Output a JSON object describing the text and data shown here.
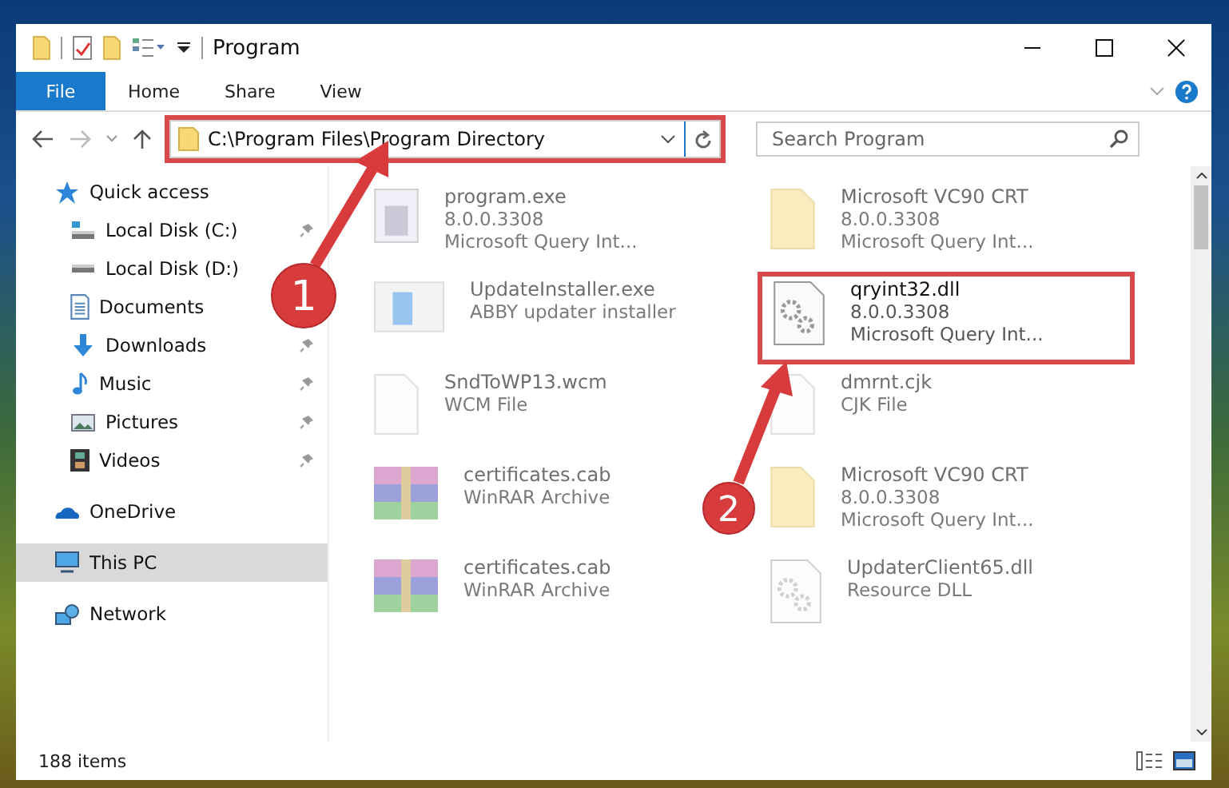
{
  "window": {
    "title": "Program"
  },
  "ribbon_tabs": [
    {
      "label": "File",
      "selected": true
    },
    {
      "label": "Home",
      "selected": false
    },
    {
      "label": "Share",
      "selected": false
    },
    {
      "label": "View",
      "selected": false
    }
  ],
  "address_bar": {
    "path": "C:\\Program Files\\Program Directory",
    "highlighted": true
  },
  "search": {
    "placeholder": "Search Program"
  },
  "sidebar": {
    "items": [
      {
        "label": "Quick access",
        "pinned": false,
        "selected": false
      },
      {
        "label": "Local Disk (C:)",
        "pinned": true,
        "selected": false
      },
      {
        "label": "Local Disk (D:)",
        "pinned": false,
        "selected": false
      },
      {
        "label": "Documents",
        "pinned": false,
        "selected": false
      },
      {
        "label": "Downloads",
        "pinned": true,
        "selected": false
      },
      {
        "label": "Music",
        "pinned": true,
        "selected": false
      },
      {
        "label": "Pictures",
        "pinned": true,
        "selected": false
      },
      {
        "label": "Videos",
        "pinned": true,
        "selected": false
      },
      {
        "label": "OneDrive",
        "pinned": false,
        "selected": false
      },
      {
        "label": "This PC",
        "pinned": false,
        "selected": true
      },
      {
        "label": "Network",
        "pinned": false,
        "selected": false
      }
    ]
  },
  "files": [
    {
      "name": "program.exe",
      "lines": [
        "8.0.0.3308",
        "Microsoft Query Int..."
      ],
      "faded": true,
      "highlighted": false
    },
    {
      "name": "Microsoft VC90 CRT",
      "lines": [
        "8.0.0.3308",
        "Microsoft Query Int..."
      ],
      "faded": true,
      "highlighted": false
    },
    {
      "name": "UpdateInstaller.exe",
      "lines": [
        "ABBY updater installer"
      ],
      "faded": true,
      "highlighted": false
    },
    {
      "name": "qryint32.dll",
      "lines": [
        "8.0.0.3308",
        "Microsoft Query Int..."
      ],
      "faded": false,
      "highlighted": true
    },
    {
      "name": "SndToWP13.wcm",
      "lines": [
        "WCM File"
      ],
      "faded": true,
      "highlighted": false
    },
    {
      "name": "dmrnt.cjk",
      "lines": [
        "CJK File"
      ],
      "faded": true,
      "highlighted": false
    },
    {
      "name": "certificates.cab",
      "lines": [
        "WinRAR Archive"
      ],
      "faded": true,
      "highlighted": false
    },
    {
      "name": "Microsoft VC90 CRT",
      "lines": [
        "8.0.0.3308",
        "Microsoft Query Int..."
      ],
      "faded": true,
      "highlighted": false
    },
    {
      "name": "certificates.cab",
      "lines": [
        "WinRAR Archive"
      ],
      "faded": true,
      "highlighted": false
    },
    {
      "name": "UpdaterClient65.dll",
      "lines": [
        "Resource DLL"
      ],
      "faded": true,
      "highlighted": false
    }
  ],
  "status_bar": {
    "item_count": "188 items"
  },
  "callouts": [
    {
      "number": "1"
    },
    {
      "number": "2"
    }
  ]
}
